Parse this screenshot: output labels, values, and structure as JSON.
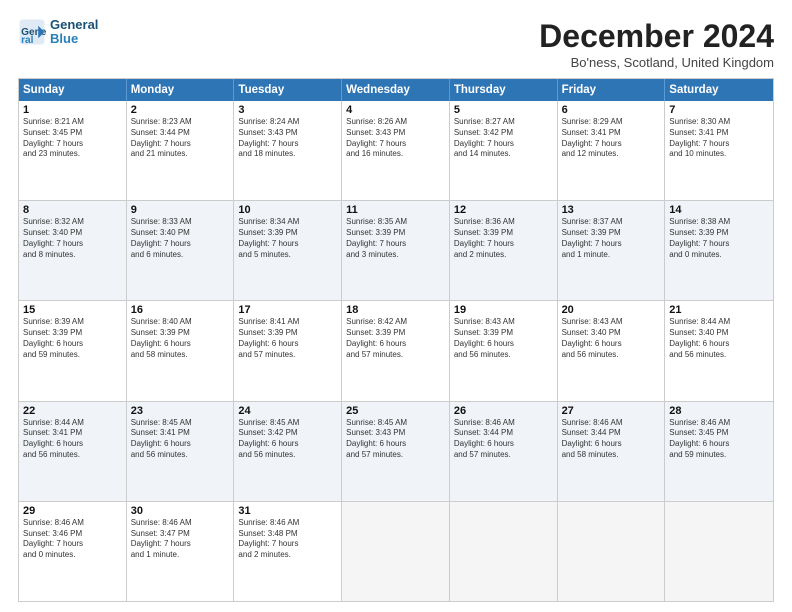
{
  "header": {
    "logo_line1": "General",
    "logo_line2": "Blue",
    "month_title": "December 2024",
    "location": "Bo'ness, Scotland, United Kingdom"
  },
  "weekdays": [
    "Sunday",
    "Monday",
    "Tuesday",
    "Wednesday",
    "Thursday",
    "Friday",
    "Saturday"
  ],
  "rows": [
    [
      {
        "day": "1",
        "text": "Sunrise: 8:21 AM\nSunset: 3:45 PM\nDaylight: 7 hours\nand 23 minutes."
      },
      {
        "day": "2",
        "text": "Sunrise: 8:23 AM\nSunset: 3:44 PM\nDaylight: 7 hours\nand 21 minutes."
      },
      {
        "day": "3",
        "text": "Sunrise: 8:24 AM\nSunset: 3:43 PM\nDaylight: 7 hours\nand 18 minutes."
      },
      {
        "day": "4",
        "text": "Sunrise: 8:26 AM\nSunset: 3:43 PM\nDaylight: 7 hours\nand 16 minutes."
      },
      {
        "day": "5",
        "text": "Sunrise: 8:27 AM\nSunset: 3:42 PM\nDaylight: 7 hours\nand 14 minutes."
      },
      {
        "day": "6",
        "text": "Sunrise: 8:29 AM\nSunset: 3:41 PM\nDaylight: 7 hours\nand 12 minutes."
      },
      {
        "day": "7",
        "text": "Sunrise: 8:30 AM\nSunset: 3:41 PM\nDaylight: 7 hours\nand 10 minutes."
      }
    ],
    [
      {
        "day": "8",
        "text": "Sunrise: 8:32 AM\nSunset: 3:40 PM\nDaylight: 7 hours\nand 8 minutes."
      },
      {
        "day": "9",
        "text": "Sunrise: 8:33 AM\nSunset: 3:40 PM\nDaylight: 7 hours\nand 6 minutes."
      },
      {
        "day": "10",
        "text": "Sunrise: 8:34 AM\nSunset: 3:39 PM\nDaylight: 7 hours\nand 5 minutes."
      },
      {
        "day": "11",
        "text": "Sunrise: 8:35 AM\nSunset: 3:39 PM\nDaylight: 7 hours\nand 3 minutes."
      },
      {
        "day": "12",
        "text": "Sunrise: 8:36 AM\nSunset: 3:39 PM\nDaylight: 7 hours\nand 2 minutes."
      },
      {
        "day": "13",
        "text": "Sunrise: 8:37 AM\nSunset: 3:39 PM\nDaylight: 7 hours\nand 1 minute."
      },
      {
        "day": "14",
        "text": "Sunrise: 8:38 AM\nSunset: 3:39 PM\nDaylight: 7 hours\nand 0 minutes."
      }
    ],
    [
      {
        "day": "15",
        "text": "Sunrise: 8:39 AM\nSunset: 3:39 PM\nDaylight: 6 hours\nand 59 minutes."
      },
      {
        "day": "16",
        "text": "Sunrise: 8:40 AM\nSunset: 3:39 PM\nDaylight: 6 hours\nand 58 minutes."
      },
      {
        "day": "17",
        "text": "Sunrise: 8:41 AM\nSunset: 3:39 PM\nDaylight: 6 hours\nand 57 minutes."
      },
      {
        "day": "18",
        "text": "Sunrise: 8:42 AM\nSunset: 3:39 PM\nDaylight: 6 hours\nand 57 minutes."
      },
      {
        "day": "19",
        "text": "Sunrise: 8:43 AM\nSunset: 3:39 PM\nDaylight: 6 hours\nand 56 minutes."
      },
      {
        "day": "20",
        "text": "Sunrise: 8:43 AM\nSunset: 3:40 PM\nDaylight: 6 hours\nand 56 minutes."
      },
      {
        "day": "21",
        "text": "Sunrise: 8:44 AM\nSunset: 3:40 PM\nDaylight: 6 hours\nand 56 minutes."
      }
    ],
    [
      {
        "day": "22",
        "text": "Sunrise: 8:44 AM\nSunset: 3:41 PM\nDaylight: 6 hours\nand 56 minutes."
      },
      {
        "day": "23",
        "text": "Sunrise: 8:45 AM\nSunset: 3:41 PM\nDaylight: 6 hours\nand 56 minutes."
      },
      {
        "day": "24",
        "text": "Sunrise: 8:45 AM\nSunset: 3:42 PM\nDaylight: 6 hours\nand 56 minutes."
      },
      {
        "day": "25",
        "text": "Sunrise: 8:45 AM\nSunset: 3:43 PM\nDaylight: 6 hours\nand 57 minutes."
      },
      {
        "day": "26",
        "text": "Sunrise: 8:46 AM\nSunset: 3:44 PM\nDaylight: 6 hours\nand 57 minutes."
      },
      {
        "day": "27",
        "text": "Sunrise: 8:46 AM\nSunset: 3:44 PM\nDaylight: 6 hours\nand 58 minutes."
      },
      {
        "day": "28",
        "text": "Sunrise: 8:46 AM\nSunset: 3:45 PM\nDaylight: 6 hours\nand 59 minutes."
      }
    ],
    [
      {
        "day": "29",
        "text": "Sunrise: 8:46 AM\nSunset: 3:46 PM\nDaylight: 7 hours\nand 0 minutes."
      },
      {
        "day": "30",
        "text": "Sunrise: 8:46 AM\nSunset: 3:47 PM\nDaylight: 7 hours\nand 1 minute."
      },
      {
        "day": "31",
        "text": "Sunrise: 8:46 AM\nSunset: 3:48 PM\nDaylight: 7 hours\nand 2 minutes."
      },
      {
        "day": "",
        "text": ""
      },
      {
        "day": "",
        "text": ""
      },
      {
        "day": "",
        "text": ""
      },
      {
        "day": "",
        "text": ""
      }
    ]
  ]
}
